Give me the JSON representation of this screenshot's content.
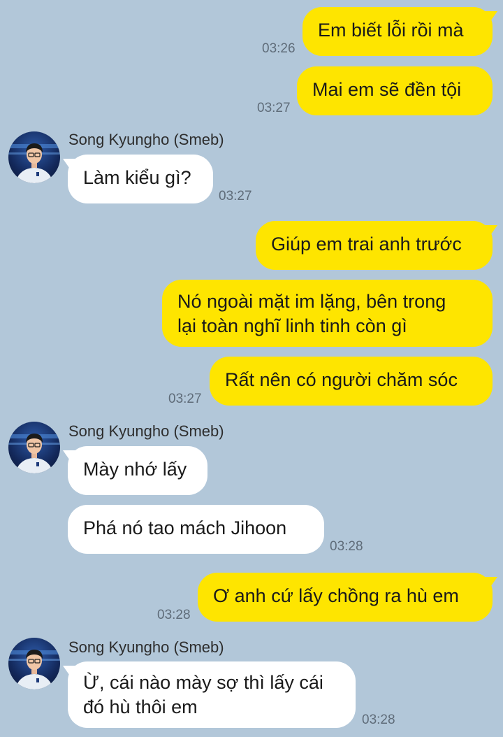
{
  "sender": {
    "name": "Song Kyungho (Smeb)",
    "avatar_icon": "profile-photo-icon"
  },
  "colors": {
    "background": "#b2c7d9",
    "outgoing_bubble": "#fee500",
    "incoming_bubble": "#ffffff"
  },
  "messages": [
    {
      "dir": "out",
      "text": "Em biết lỗi rồi mà",
      "time": "03:26"
    },
    {
      "dir": "out",
      "text": "Mai em sẽ đền tội",
      "time": "03:27"
    },
    {
      "dir": "in",
      "text": "Làm kiểu gì?",
      "time": "03:27"
    },
    {
      "dir": "out",
      "text": "Giúp em trai anh trước"
    },
    {
      "dir": "out",
      "lines": [
        "Nó ngoài mặt im lặng, bên trong",
        "lại toàn nghĩ linh tinh còn gì"
      ]
    },
    {
      "dir": "out",
      "text": "Rất nên có người chăm sóc",
      "time": "03:27"
    },
    {
      "dir": "in",
      "text": "Mày nhớ lấy"
    },
    {
      "dir": "in",
      "text": "Phá nó tao mách Jihoon",
      "time": "03:28"
    },
    {
      "dir": "out",
      "text": "Ơ anh cứ lấy chồng ra hù em",
      "time": "03:28"
    },
    {
      "dir": "in",
      "lines": [
        "Ừ, cái nào mày sợ thì lấy cái",
        "đó hù thôi em"
      ],
      "time": "03:28"
    }
  ]
}
